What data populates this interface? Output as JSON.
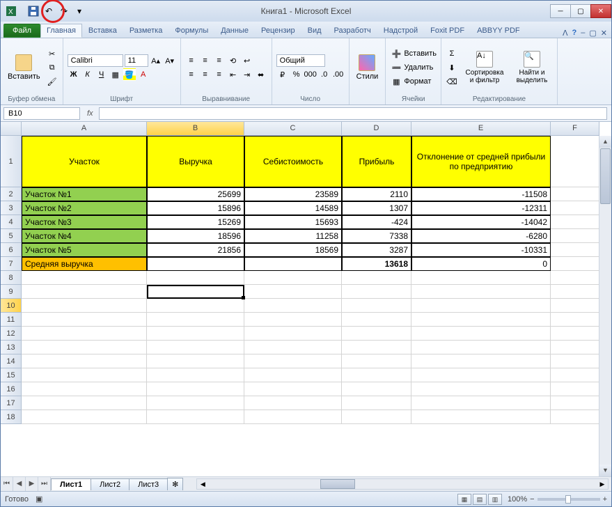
{
  "window": {
    "title": "Книга1  -  Microsoft Excel"
  },
  "tabs": {
    "file": "Файл",
    "items": [
      "Главная",
      "Вставка",
      "Разметка",
      "Формулы",
      "Данные",
      "Рецензир",
      "Вид",
      "Разработч",
      "Надстрой",
      "Foxit PDF",
      "ABBYY PDF"
    ],
    "active_index": 0
  },
  "ribbon": {
    "paste": "Вставить",
    "clipboard_label": "Буфер обмена",
    "font_name": "Calibri",
    "font_size": "11",
    "font_label": "Шрифт",
    "align_label": "Выравнивание",
    "number_format": "Общий",
    "number_label": "Число",
    "styles": "Стили",
    "insert_btn": "Вставить",
    "delete_btn": "Удалить",
    "format_btn": "Формат",
    "cells_label": "Ячейки",
    "sort": "Сортировка и фильтр",
    "find": "Найти и выделить",
    "editing_label": "Редактирование"
  },
  "namebox": "B10",
  "columns": [
    "A",
    "B",
    "C",
    "D",
    "E",
    "F"
  ],
  "headers": {
    "A": "Участок",
    "B": "Выручка",
    "C": "Себистоимость",
    "D": "Прибыль",
    "E": "Отклонение от средней прибыли по предприятию"
  },
  "rows": [
    {
      "n": "2",
      "A": "Участок №1",
      "B": "25699",
      "C": "23589",
      "D": "2110",
      "E": "-11508"
    },
    {
      "n": "3",
      "A": "Участок №2",
      "B": "15896",
      "C": "14589",
      "D": "1307",
      "E": "-12311"
    },
    {
      "n": "4",
      "A": "Участок №3",
      "B": "15269",
      "C": "15693",
      "D": "-424",
      "E": "-14042"
    },
    {
      "n": "5",
      "A": "Участок №4",
      "B": "18596",
      "C": "11258",
      "D": "7338",
      "E": "-6280"
    },
    {
      "n": "6",
      "A": "Участок №5",
      "B": "21856",
      "C": "18569",
      "D": "3287",
      "E": "-10331"
    }
  ],
  "summary": {
    "n": "7",
    "A": "Средняя выручка",
    "D": "13618",
    "E": "0"
  },
  "empty_rows": [
    "8",
    "9",
    "10",
    "11",
    "12",
    "13",
    "14",
    "15",
    "16",
    "17",
    "18"
  ],
  "sheets": [
    "Лист1",
    "Лист2",
    "Лист3"
  ],
  "status": {
    "ready": "Готово",
    "zoom": "100%"
  }
}
